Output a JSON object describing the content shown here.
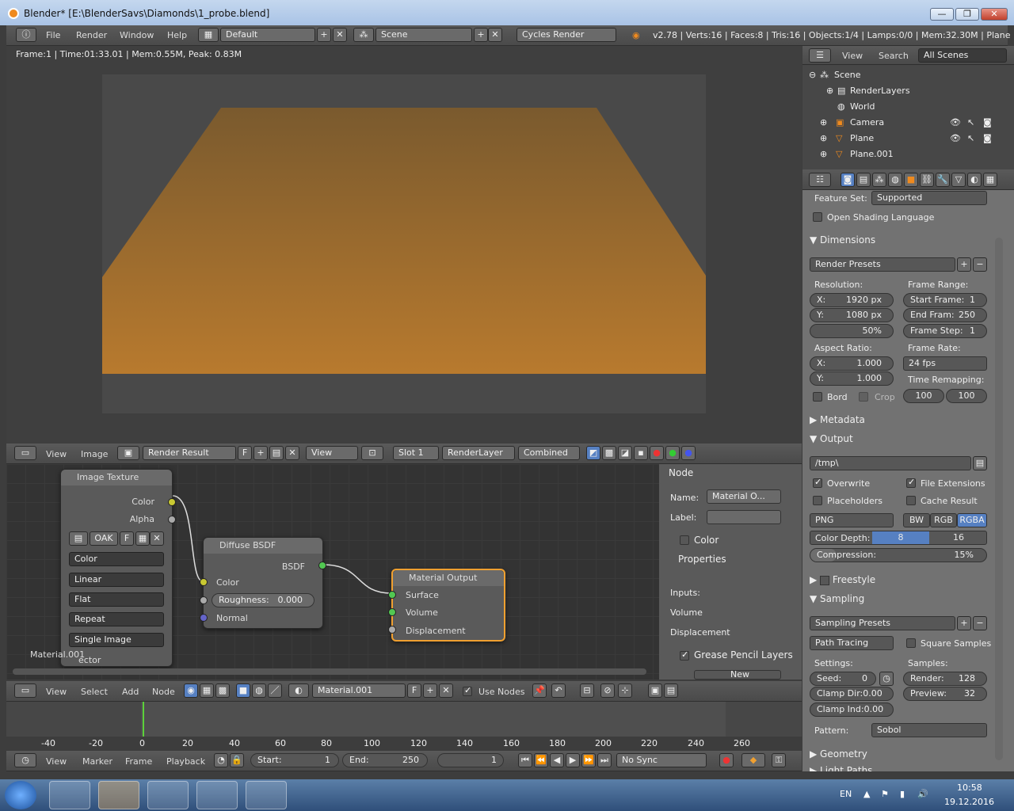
{
  "window": {
    "title": "Blender* [E:\\BlenderSavs\\Diamonds\\1_probe.blend]",
    "min": "—",
    "max": "❐",
    "close": "✕"
  },
  "topbar": {
    "menus": [
      "File",
      "Render",
      "Window",
      "Help"
    ],
    "layout": "Default",
    "scene": "Scene",
    "engine": "Cycles Render",
    "stats": "v2.78 | Verts:16 | Faces:8 | Tris:16 | Objects:1/4 | Lamps:0/0 | Mem:32.30M | Plane"
  },
  "viewport": {
    "info": "Frame:1 | Time:01:33.01 | Mem:0.55M, Peak: 0.83M",
    "colors": {
      "plane_top": "#7a5a2e",
      "plane_bottom": "#b87a2e"
    }
  },
  "image_header": {
    "view": "View",
    "image": "Image",
    "result": "Render Result",
    "f": "F",
    "view2": "View",
    "slot": "Slot 1",
    "layer": "RenderLayer",
    "pass": "Combined"
  },
  "nodes": {
    "image_texture": {
      "title": "Image Texture",
      "color": "Color",
      "alpha": "Alpha",
      "img": "OAK",
      "f": "F",
      "opts": [
        "Color",
        "Linear",
        "Flat",
        "Repeat",
        "Single Image"
      ],
      "vector": "ector"
    },
    "diffuse": {
      "title": "Diffuse BSDF",
      "bsdf": "BSDF",
      "color": "Color",
      "roughness": "Roughness:",
      "roughness_val": "0.000",
      "normal": "Normal"
    },
    "output": {
      "title": "Material Output",
      "surface": "Surface",
      "volume": "Volume",
      "displacement": "Displacement"
    },
    "material_label": "Material.001"
  },
  "node_panel": {
    "node": "Node",
    "name_lbl": "Name:",
    "name_val": "Material O...",
    "label_lbl": "Label:",
    "color": "Color",
    "properties": "Properties",
    "inputs": "Inputs:",
    "volume": "Volume",
    "displacement": "Displacement",
    "grease": "Grease Pencil Layers",
    "new": "New"
  },
  "node_header": {
    "view": "View",
    "select": "Select",
    "add": "Add",
    "node": "Node",
    "material": "Material.001",
    "f": "F",
    "use_nodes": "Use Nodes"
  },
  "timeline": {
    "ticks": [
      "-40",
      "-20",
      "0",
      "20",
      "40",
      "60",
      "80",
      "100",
      "120",
      "140",
      "160",
      "180",
      "200",
      "220",
      "240",
      "260"
    ],
    "view": "View",
    "marker": "Marker",
    "frame": "Frame",
    "playback": "Playback",
    "start_lbl": "Start:",
    "start": "1",
    "end_lbl": "End:",
    "end": "250",
    "current": "1",
    "sync": "No Sync"
  },
  "outliner": {
    "view": "View",
    "search": "Search",
    "filter": "All Scenes",
    "items": [
      "Scene",
      "RenderLayers",
      "World",
      "Camera",
      "Plane",
      "Plane.001"
    ]
  },
  "props": {
    "feature_set_lbl": "Feature Set:",
    "feature_set": "Supported",
    "osl": "Open Shading Language",
    "dimensions": "Dimensions",
    "render_presets": "Render Presets",
    "resolution": "Resolution:",
    "frame_range": "Frame Range:",
    "res_x": "X:",
    "res_x_val": "1920 px",
    "res_y": "Y:",
    "res_y_val": "1080 px",
    "res_pct": "50%",
    "start_frame": "Start Frame:",
    "start_frame_val": "1",
    "end_frame": "End Fram:",
    "end_frame_val": "250",
    "frame_step": "Frame Step:",
    "frame_step_val": "1",
    "aspect": "Aspect Ratio:",
    "frame_rate": "Frame Rate:",
    "asp_x": "X:",
    "asp_x_val": "1.000",
    "asp_y": "Y:",
    "asp_y_val": "1.000",
    "fps": "24 fps",
    "time_remap": "Time Remapping:",
    "remap_old": "100",
    "remap_new": "100",
    "border": "Bord",
    "crop": "Crop",
    "metadata": "Metadata",
    "output": "Output",
    "path": "/tmp\\",
    "overwrite": "Overwrite",
    "file_ext": "File Extensions",
    "placeholders": "Placeholders",
    "cache": "Cache Result",
    "format": "PNG",
    "bw": "BW",
    "rgb": "RGB",
    "rgba": "RGBA",
    "color_depth": "Color Depth:",
    "depth8": "8",
    "depth16": "16",
    "compression": "Compression:",
    "compression_val": "15%",
    "freestyle": "Freestyle",
    "sampling": "Sampling",
    "sampling_presets": "Sampling Presets",
    "path_tracing": "Path Tracing",
    "square_samples": "Square Samples",
    "settings": "Settings:",
    "samples": "Samples:",
    "seed": "Seed:",
    "seed_val": "0",
    "render": "Render:",
    "render_val": "128",
    "clamp_dir": "Clamp Dir:0.00",
    "preview": "Preview:",
    "preview_val": "32",
    "clamp_ind": "Clamp Ind:0.00",
    "pattern": "Pattern:",
    "pattern_val": "Sobol",
    "geometry": "Geometry",
    "light_paths": "Light Paths"
  },
  "taskbar": {
    "lang": "EN",
    "time": "10:58",
    "date": "19.12.2016"
  }
}
